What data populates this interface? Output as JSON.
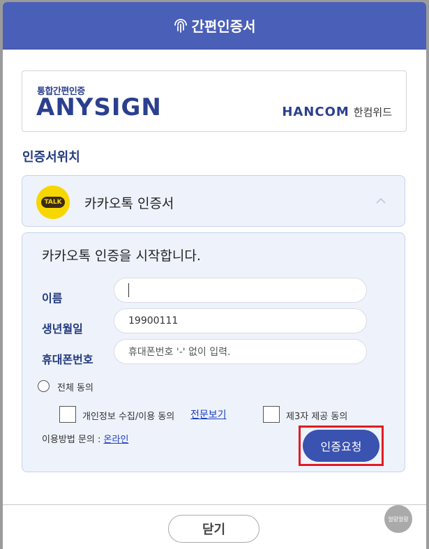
{
  "header": {
    "title": "간편인증서"
  },
  "brand": {
    "subtitle": "통합간편인증",
    "logo": "ANYSIGN",
    "partner_en": "HANCOM",
    "partner_ko": "한컴위드"
  },
  "section": {
    "label": "인증서위치"
  },
  "provider": {
    "badge": "TALK",
    "name": "카카오톡 인증서"
  },
  "panel": {
    "headline": "카카오톡 인증을 시작합니다.",
    "fields": {
      "name_label": "이름",
      "name_value": "",
      "birth_label": "생년월일",
      "birth_value": "19900111",
      "phone_label": "휴대폰번호",
      "phone_placeholder": "휴대폰번호 '-' 없이 입력."
    },
    "consent": {
      "all_label": "전체 동의",
      "privacy_label": "개인정보 수집/이용 동의",
      "view_full": "전문보기",
      "third_party_label": "제3자 제공 동의"
    },
    "inquiry": {
      "label": "이용방법 문의 : ",
      "link": "온라인"
    },
    "request_button": "인증요청"
  },
  "footer": {
    "close_button": "닫기",
    "mascot": "얼랑얼랑"
  },
  "colors": {
    "header": "#4a5fb7",
    "accent": "#3a52b0",
    "highlight": "#e01b24"
  }
}
